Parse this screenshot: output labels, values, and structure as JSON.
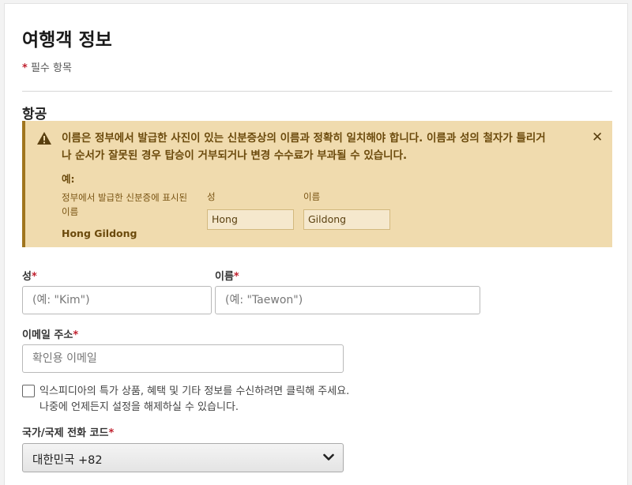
{
  "page": {
    "title": "여행객 정보",
    "required_star": "*",
    "required_note": " 필수 항목"
  },
  "section": {
    "title": "항공"
  },
  "alert": {
    "icon": "warning-icon",
    "message": "이름은 정부에서 발급한 사진이 있는 신분증상의 이름과 정확히 일치해야 합니다. 이름과 성의 철자가 틀리거나 순서가 잘못된 경우 탑승이 거부되거나 변경 수수료가 부과될 수 있습니다.",
    "close_icon": "close-icon",
    "example_label": "예:",
    "example_desc": "정부에서 발급한 신분증에 표시된 이름",
    "example_name": "Hong Gildong",
    "last_name_label": "성",
    "first_name_label": "이름",
    "last_name_value": "Hong",
    "first_name_value": "Gildong"
  },
  "form": {
    "last_name": {
      "label": "성",
      "star": "*",
      "placeholder": "(예: \"Kim\")",
      "value": ""
    },
    "first_name": {
      "label": "이름",
      "star": "*",
      "placeholder": "(예: \"Taewon\")",
      "value": ""
    },
    "email": {
      "label": "이메일 주소",
      "star": "*",
      "placeholder": "확인용 이메일",
      "value": ""
    },
    "marketing_checkbox": {
      "checked": false,
      "label": "익스피디아의 특가 상품, 혜택 및 기타 정보를 수신하려면 클릭해 주세요. 나중에 언제든지 설정을 해제하실 수 있습니다."
    },
    "phone_code": {
      "label": "국가/국제 전화 코드",
      "star": "*",
      "selected": "대한민국 +82"
    }
  },
  "colors": {
    "alert_bg": "#f0dbae",
    "alert_border": "#a0751e",
    "required": "#c0202e"
  }
}
